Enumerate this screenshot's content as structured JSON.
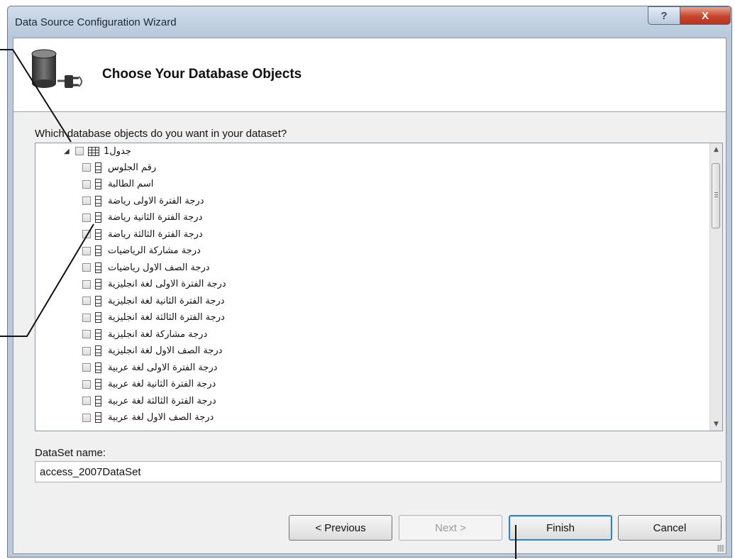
{
  "window": {
    "title": "Data Source Configuration Wizard",
    "help_glyph": "?",
    "close_glyph": "X"
  },
  "header": {
    "title": "Choose Your Database Objects",
    "icon": "database-plug-icon"
  },
  "question": "Which database objects do you want in your dataset?",
  "tree": {
    "table": {
      "label": "جدول1",
      "icon": "table-icon",
      "expanded": true
    },
    "columns": [
      "رقم الجلوس",
      "اسم الطالبة",
      "درجة الفترة الاولى رياضة",
      "درجة الفترة الثانية رياضة",
      "درجة الفترة الثالثة رياضة",
      "درجة مشاركة الرياضيات",
      "درجة الصف الاول رياضيات",
      "درجة الفترة الاولى لغة انجليزية",
      "درجة الفترة الثانية لغة انجليزية",
      "درجة الفترة الثالثة لغة انجليزية",
      "درجة مشاركة لغة انجليزية",
      "درجة الصف الاول لغة انجليزية",
      "درجة الفترة الاولى لغة عربية",
      "درجة الفترة الثانية لغة عربية",
      "درجة الفترة الثالثة لغة عربية",
      "درجة الصف الاول لغة عربية"
    ]
  },
  "dataset": {
    "label": "DataSet name:",
    "value": "access_2007DataSet"
  },
  "buttons": {
    "previous": "< Previous",
    "next": "Next >",
    "finish": "Finish",
    "cancel": "Cancel"
  },
  "colors": {
    "accent": "#3c7fb1",
    "close": "#c7442b"
  }
}
